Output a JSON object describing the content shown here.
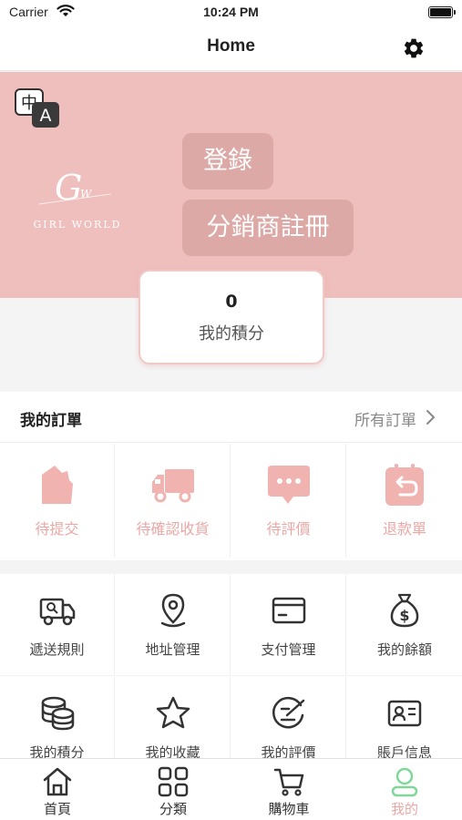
{
  "status_bar": {
    "carrier": "Carrier",
    "time": "10:24 PM"
  },
  "navbar": {
    "title": "Home"
  },
  "hero": {
    "logo_text": "GIRL WORLD",
    "login_label": "登錄",
    "register_label": "分銷商註冊"
  },
  "points": {
    "value": "0",
    "label": "我的積分"
  },
  "orders": {
    "title": "我的訂單",
    "all_label": "所有訂單",
    "items": [
      {
        "label": "待提交",
        "icon": "bag-icon"
      },
      {
        "label": "待確認收貨",
        "icon": "truck-icon"
      },
      {
        "label": "待評價",
        "icon": "chat-bubble-icon"
      },
      {
        "label": "退款單",
        "icon": "refund-icon"
      }
    ]
  },
  "tools": [
    {
      "label": "遞送規則",
      "icon": "delivery-truck-icon"
    },
    {
      "label": "地址管理",
      "icon": "location-pin-icon"
    },
    {
      "label": "支付管理",
      "icon": "credit-card-icon"
    },
    {
      "label": "我的餘額",
      "icon": "money-bag-icon"
    },
    {
      "label": "我的積分",
      "icon": "coins-stack-icon"
    },
    {
      "label": "我的收藏",
      "icon": "star-icon"
    },
    {
      "label": "我的評價",
      "icon": "review-check-icon"
    },
    {
      "label": "賬戶信息",
      "icon": "id-card-icon"
    }
  ],
  "tabbar": [
    {
      "label": "首頁",
      "icon": "home-icon",
      "active": false
    },
    {
      "label": "分類",
      "icon": "grid-icon",
      "active": false
    },
    {
      "label": "購物車",
      "icon": "cart-icon",
      "active": false
    },
    {
      "label": "我的",
      "icon": "user-icon",
      "active": true
    }
  ],
  "colors": {
    "brand_pink": "#efbfbd",
    "accent_pink": "#e9a8a6",
    "active_green": "#7fd89a"
  }
}
